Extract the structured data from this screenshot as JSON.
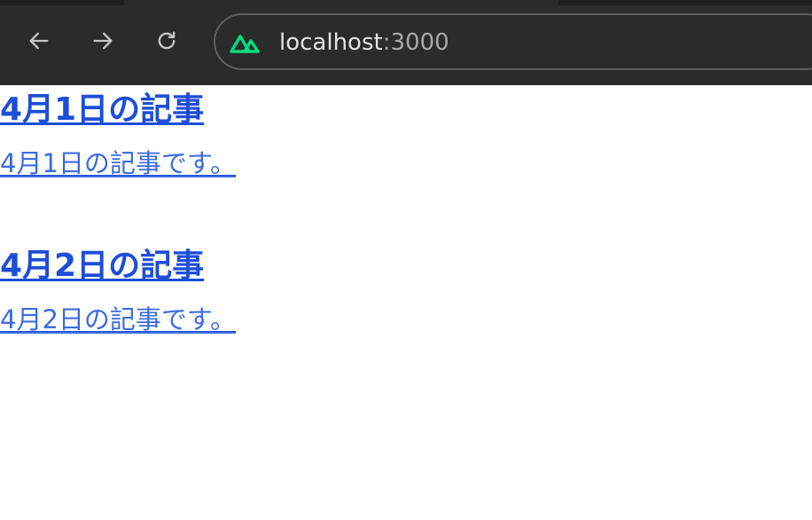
{
  "browser": {
    "url_host": "localhost",
    "url_port": ":3000",
    "icons": {
      "back": "arrow-left-icon",
      "forward": "arrow-right-icon",
      "reload": "reload-icon",
      "site": "nuxt-logo-icon"
    },
    "colors": {
      "chrome_bg": "#2b2b2b",
      "site_icon": "#00dc82"
    }
  },
  "articles": [
    {
      "title": "4月1日の記事",
      "body": "4月1日の記事です。"
    },
    {
      "title": "4月2日の記事",
      "body": "4月2日の記事です。"
    }
  ],
  "colors": {
    "link_title": "#1d4ed8",
    "link_body": "#3b6be0"
  }
}
